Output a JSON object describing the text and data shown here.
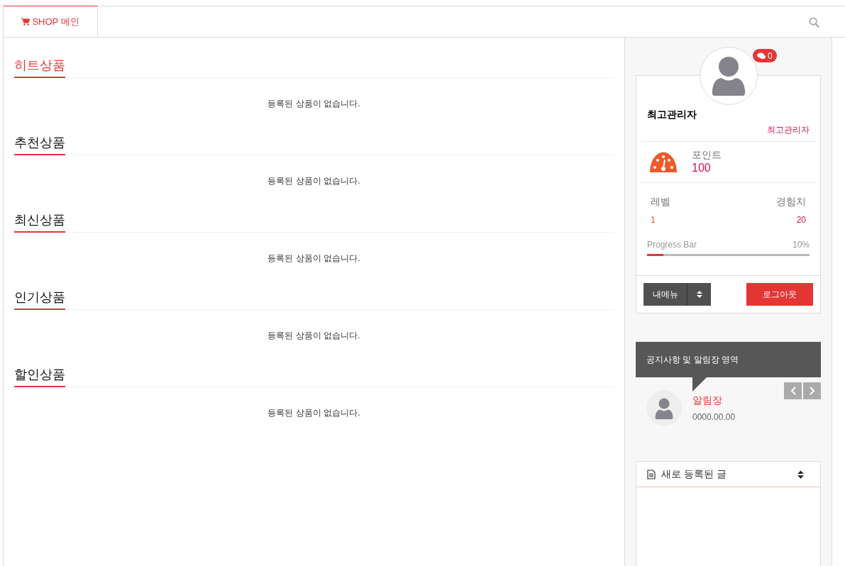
{
  "tabs": [
    {
      "label": "SHOP 메인",
      "selected": true
    }
  ],
  "sections": [
    {
      "title": "히트상품",
      "highlighted": true,
      "empty_text": "등록된 상품이 없습니다."
    },
    {
      "title": "추천상품",
      "highlighted": false,
      "empty_text": "등록된 상품이 없습니다."
    },
    {
      "title": "최신상품",
      "highlighted": false,
      "empty_text": "등록된 상품이 없습니다."
    },
    {
      "title": "인기상품",
      "highlighted": false,
      "empty_text": "등록된 상품이 없습니다."
    },
    {
      "title": "할인상품",
      "highlighted": false,
      "empty_text": "등록된 상품이 없습니다."
    }
  ],
  "profile": {
    "memo_count": "0",
    "name": "최고관리자",
    "grade": "최고관리자",
    "point_label": "포인트",
    "point_value": "100",
    "level_label": "레벨",
    "level_value": "1",
    "exp_label": "경험치",
    "exp_value": "20",
    "progress_label": "Progress Bar",
    "progress_reading": "10%",
    "level": 0.1,
    "menu_button": "내메뉴",
    "logout_button": "로그아웃"
  },
  "notice": {
    "title": "공지사항 및 알림장 영역",
    "item_title": "알림장",
    "item_date": "0000.00.00"
  },
  "new_posts": {
    "title": "새로 등록된 글"
  }
}
